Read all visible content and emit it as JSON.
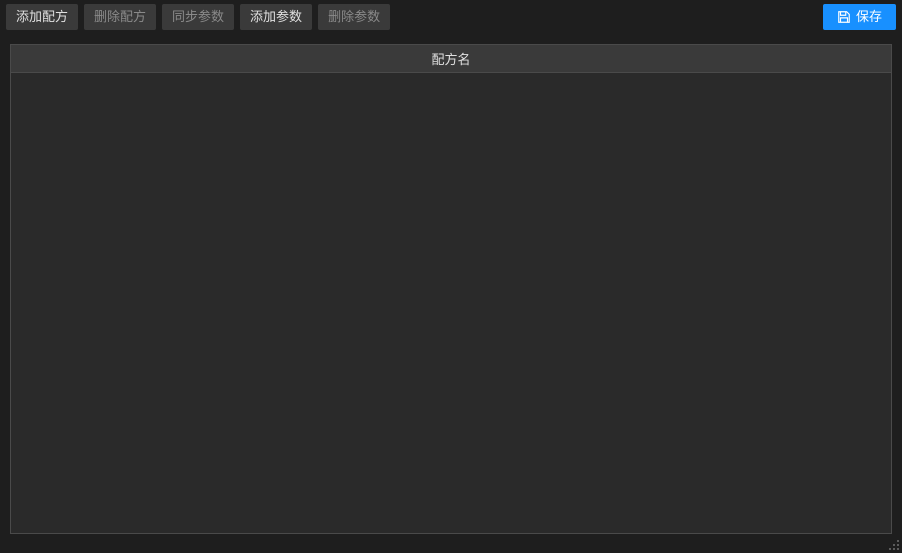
{
  "toolbar": {
    "add_recipe_label": "添加配方",
    "delete_recipe_label": "删除配方",
    "sync_params_label": "同步参数",
    "add_param_label": "添加参数",
    "delete_param_label": "删除参数",
    "save_label": "保存"
  },
  "table": {
    "header": "配方名",
    "rows": []
  }
}
